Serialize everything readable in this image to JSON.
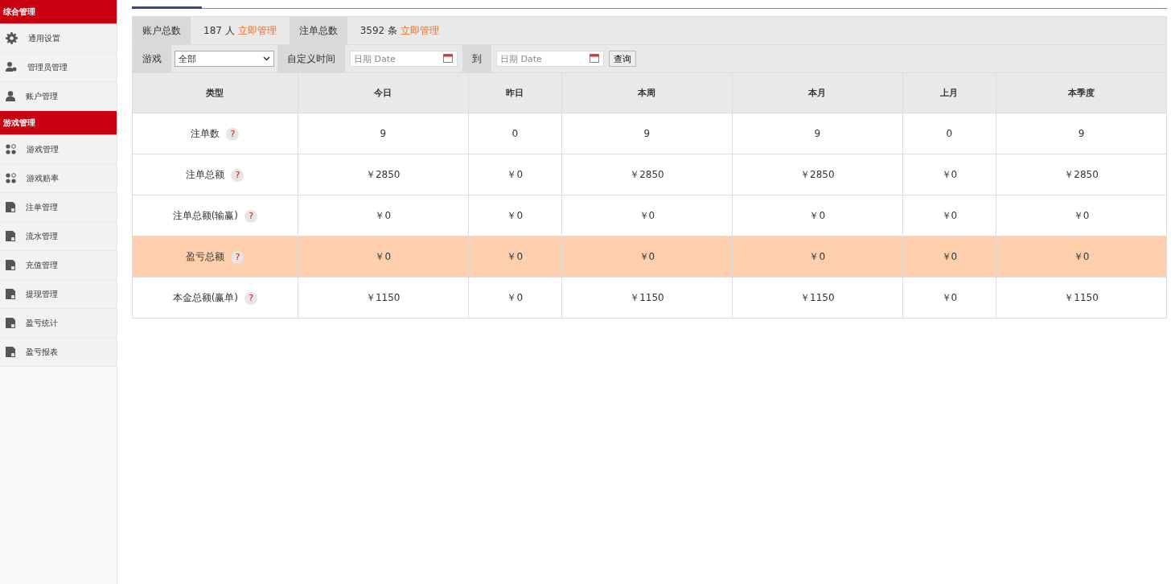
{
  "sidebar": {
    "groups": [
      {
        "title": "综合管理",
        "items": [
          {
            "label": "通用设置",
            "kind": "gear"
          },
          {
            "label": "管理员管理",
            "kind": "users"
          },
          {
            "label": "账户管理",
            "kind": "user"
          }
        ]
      },
      {
        "title": "游戏管理",
        "items": [
          {
            "label": "游戏管理",
            "kind": "apps"
          },
          {
            "label": "游戏赔率",
            "kind": "apps"
          },
          {
            "label": "注单管理",
            "kind": "doc"
          },
          {
            "label": "流水管理",
            "kind": "doc"
          },
          {
            "label": "充值管理",
            "kind": "doc"
          },
          {
            "label": "提现管理",
            "kind": "doc"
          },
          {
            "label": "盈亏统计",
            "kind": "doc"
          },
          {
            "label": "盈亏报表",
            "kind": "doc"
          }
        ]
      }
    ]
  },
  "stats": [
    {
      "label": "账户总数",
      "value": "187 人",
      "link": "立即管理"
    },
    {
      "label": "注单总数",
      "value": "3592 条",
      "link": "立即管理"
    }
  ],
  "filters": {
    "game_label": "游戏",
    "game_value": "全部",
    "time_label": "自定义时间",
    "from_placeholder": "日期 Date",
    "to_label": "到",
    "to_placeholder": "日期 Date",
    "query_button": "查询"
  },
  "table": {
    "columns": [
      "类型",
      "今日",
      "昨日",
      "本周",
      "本月",
      "上月",
      "本季度"
    ],
    "rows": [
      {
        "help": "?",
        "highlighted": false,
        "cells": [
          "注单数",
          "9",
          "0",
          "9",
          "9",
          "0",
          "9"
        ]
      },
      {
        "help": "?",
        "highlighted": false,
        "cells": [
          "注单总额",
          "￥2850",
          "￥0",
          "￥2850",
          "￥2850",
          "￥0",
          "￥2850"
        ]
      },
      {
        "help": "?",
        "highlighted": false,
        "cells": [
          "注单总额(输赢)",
          "￥0",
          "￥0",
          "￥0",
          "￥0",
          "￥0",
          "￥0"
        ]
      },
      {
        "help": "?",
        "highlighted": true,
        "cells": [
          "盈亏总额",
          "￥0",
          "￥0",
          "￥0",
          "￥0",
          "￥0",
          "￥0"
        ]
      },
      {
        "help": "?",
        "highlighted": false,
        "cells": [
          "本金总额(赢单)",
          "￥1150",
          "￥0",
          "￥1150",
          "￥1150",
          "￥0",
          "￥1150"
        ]
      }
    ]
  }
}
